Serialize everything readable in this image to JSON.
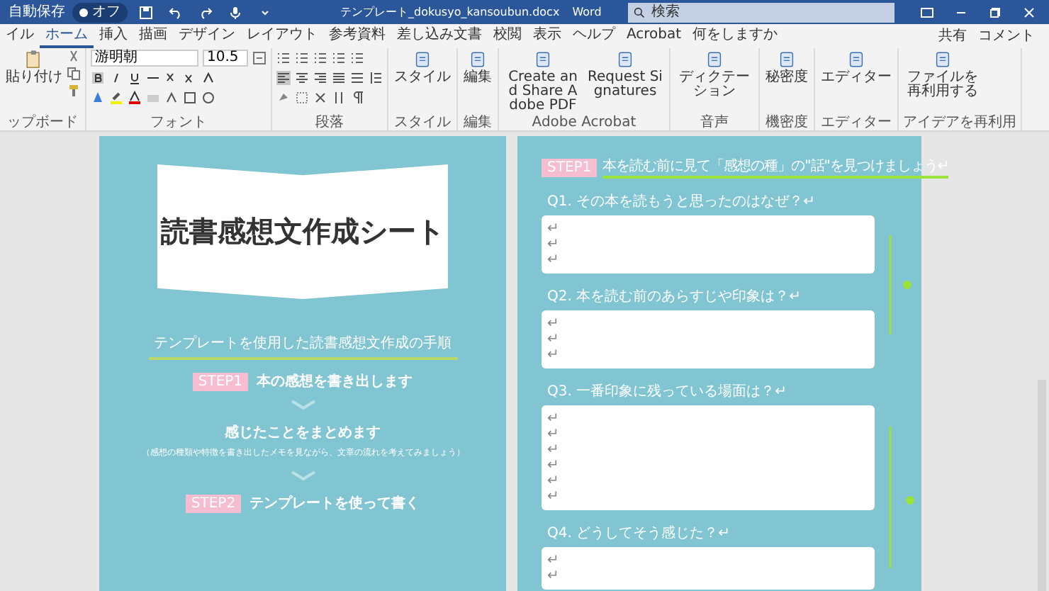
{
  "title_bar": {
    "autosave_label": "自動保存",
    "autosave_on": false,
    "autosave_state": "オフ",
    "file_name": "テンプレート_dokusyo_kansoubun.docx",
    "app_name": "Word",
    "search": {
      "placeholder": "検索"
    }
  },
  "tabs": [
    {
      "label": "イル",
      "selected": false
    },
    {
      "label": "ホーム",
      "selected": true
    },
    {
      "label": "挿入",
      "selected": false
    },
    {
      "label": "描画",
      "selected": false
    },
    {
      "label": "デザイン",
      "selected": false
    },
    {
      "label": "レイアウト",
      "selected": false
    },
    {
      "label": "参考資料",
      "selected": false
    },
    {
      "label": "差し込み文書",
      "selected": false
    },
    {
      "label": "校閲",
      "selected": false
    },
    {
      "label": "表示",
      "selected": false
    },
    {
      "label": "ヘルプ",
      "selected": false
    },
    {
      "label": "Acrobat",
      "selected": false
    },
    {
      "label": "何をしますか",
      "selected": false
    }
  ],
  "share_button": "共有",
  "comment_button": "コメント",
  "ribbon": [
    {
      "kind": "clipboard",
      "label": "ップボード",
      "buttons": [
        {
          "label": "貼り付け"
        }
      ]
    },
    {
      "kind": "font",
      "label": "フォント",
      "font_name": "游明朝",
      "font_size": "10.5"
    },
    {
      "kind": "paragraph",
      "label": "段落"
    },
    {
      "kind": "large",
      "label": "スタイル",
      "buttons": [
        {
          "label": "スタイル"
        }
      ]
    },
    {
      "kind": "large",
      "label": "編集",
      "buttons": [
        {
          "label": "編集"
        }
      ]
    },
    {
      "kind": "large",
      "label": "Adobe Acrobat",
      "buttons": [
        {
          "label": "Create and Share Adobe PDF"
        },
        {
          "label": "Request Signatures"
        }
      ]
    },
    {
      "kind": "large",
      "label": "音声",
      "buttons": [
        {
          "label": "ディクテーション"
        }
      ]
    },
    {
      "kind": "large",
      "label": "機密度",
      "buttons": [
        {
          "label": "秘密度"
        }
      ]
    },
    {
      "kind": "large",
      "label": "エディター",
      "buttons": [
        {
          "label": "エディター"
        }
      ]
    },
    {
      "kind": "large",
      "label": "アイデアを再利用",
      "buttons": [
        {
          "label": "ファイルを再利用する"
        }
      ]
    }
  ],
  "left_page": {
    "title": "読書感想文作成シート",
    "heading": "テンプレートを使用した読書感想文作成の手順",
    "steps": [
      {
        "badge": "STEP1",
        "text": "本の感想を書き出します"
      },
      {
        "text": "感じたことをまとめます",
        "note": "（感想の種類や特徴を書き出したメモを見ながら、文章の流れを考えてみましょう）"
      },
      {
        "badge": "STEP2",
        "text": "テンプレートを使って書く"
      }
    ]
  },
  "right_page": {
    "badge": "STEP1",
    "heading": "本を読む前に見て「感想の種」の\"話\"を見つけましょう↵",
    "questions": [
      {
        "label": "Q1. その本を読もうと思ったのはなぜ？↵",
        "lines": [
          "↵",
          "↵",
          "↵"
        ]
      },
      {
        "label": "Q2. 本を読む前のあらすじや印象は？↵",
        "lines": [
          "↵",
          "↵",
          "↵"
        ]
      },
      {
        "label": "Q3. 一番印象に残っている場面は？↵",
        "lines": [
          "↵",
          "↵",
          "↵",
          "↵",
          "↵",
          "↵"
        ]
      },
      {
        "label": "Q4. どうしてそう感じた？↵",
        "lines": [
          "↵",
          "↵"
        ]
      }
    ]
  }
}
